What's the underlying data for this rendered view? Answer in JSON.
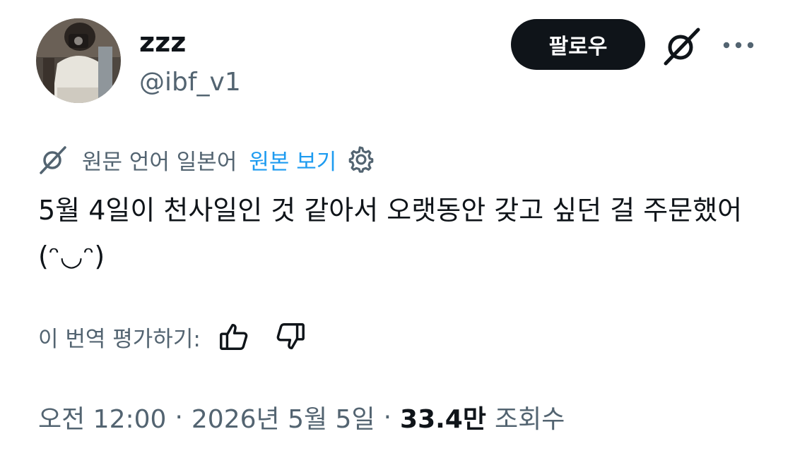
{
  "user": {
    "display_name": "zzz",
    "handle": "@ibf_v1"
  },
  "header": {
    "follow_label": "팔로우",
    "grok_icon": "grok-icon",
    "more_icon": "more-dots-icon"
  },
  "translation": {
    "source_language_text": "원문 언어 일본어",
    "show_original_label": "원본 보기",
    "settings_icon": "gear-icon"
  },
  "tweet": {
    "text": "5월 4일이 천사일인 것 같아서 오랫동안 갖고 싶던 걸 주문했어(ᵔ◡ᵔ)"
  },
  "rating": {
    "prompt": "이 번역 평가하기:",
    "thumbs_up_icon": "thumbs-up-icon",
    "thumbs_down_icon": "thumbs-down-icon"
  },
  "meta": {
    "time": "오전 12:00",
    "date": "2026년 5월 5일",
    "separator": "·",
    "views_count": "33.4만",
    "views_label": "조회수"
  },
  "colors": {
    "text_primary": "#0f1419",
    "text_secondary": "#536471",
    "link": "#1d9bf0",
    "button_bg": "#0f1419"
  }
}
